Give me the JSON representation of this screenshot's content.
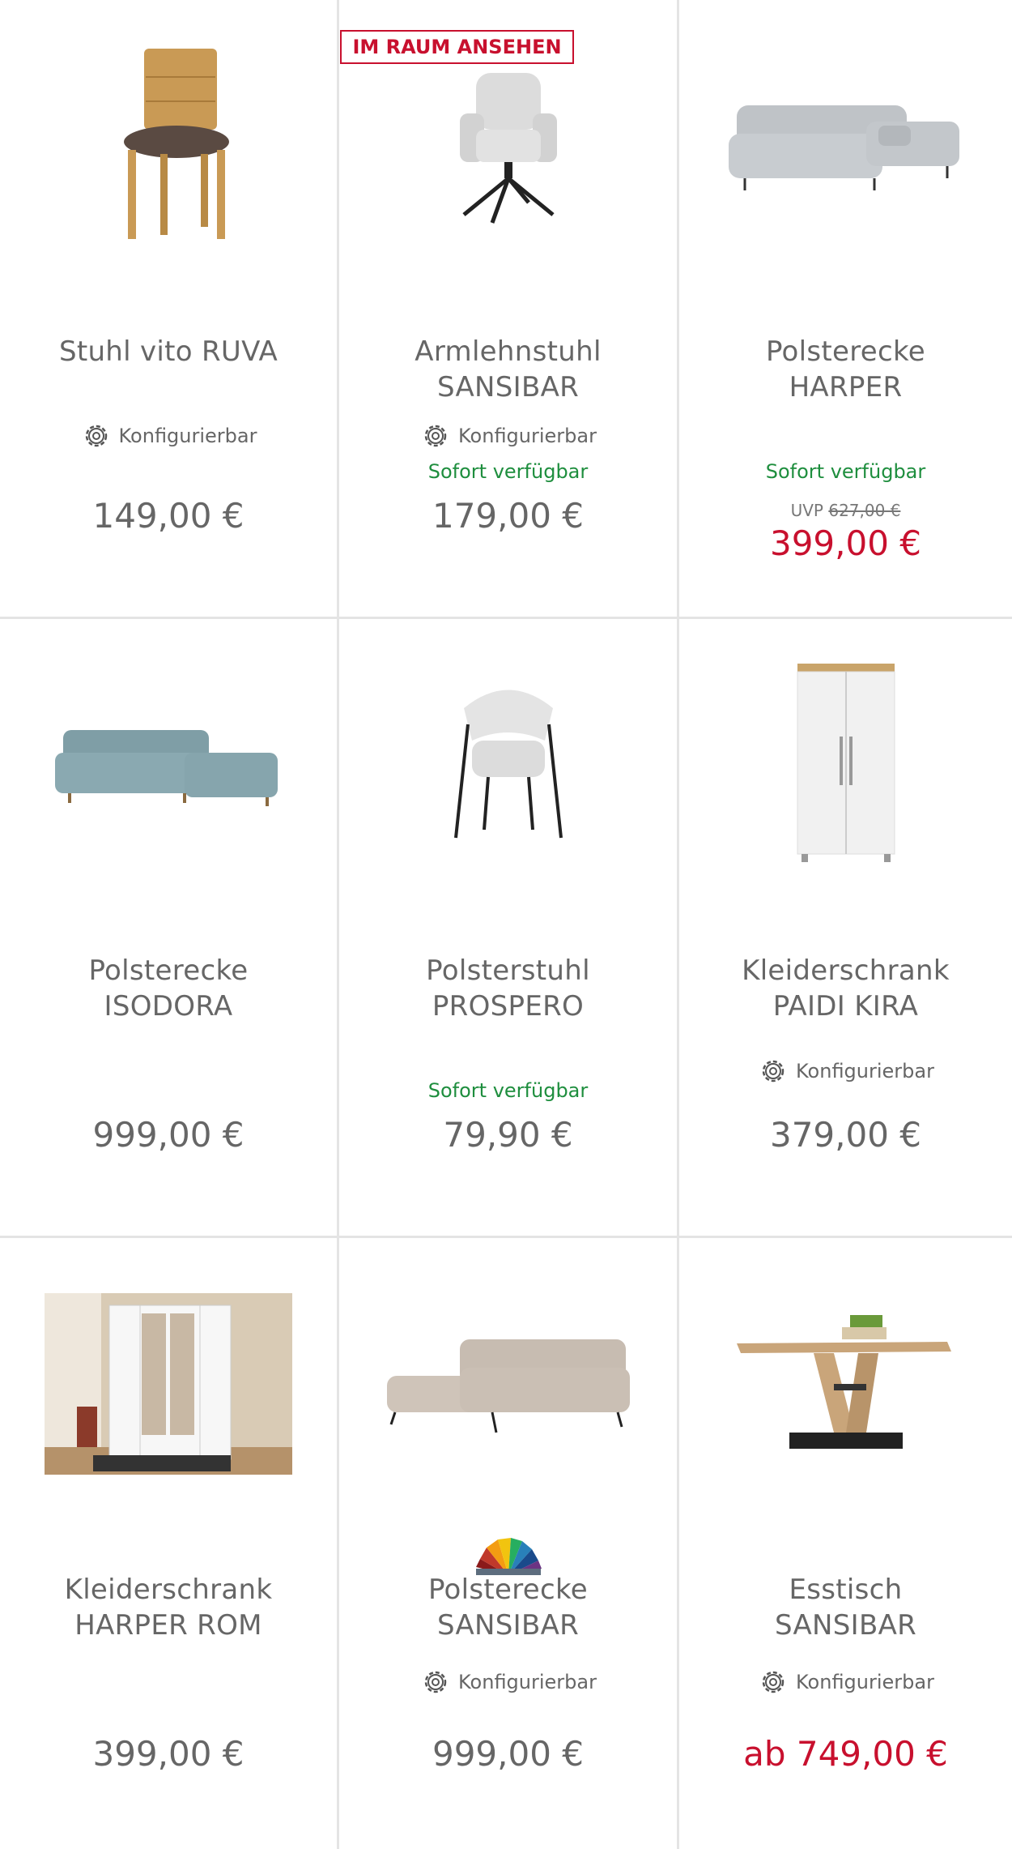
{
  "badge": "IM RAUM ANSEHEN",
  "products": [
    {
      "title_l1": "Stuhl vito RUVA",
      "title_l2": "",
      "config": "Konfigurierbar",
      "availability": "",
      "uvp_label": "",
      "uvp_value": "",
      "price": "149,00 €",
      "image": "wooden-chair-icon"
    },
    {
      "title_l1": "Armlehnstuhl",
      "title_l2": "SANSIBAR",
      "config": "Konfigurierbar",
      "availability": "Sofort verfügbar",
      "uvp_label": "",
      "uvp_value": "",
      "price": "179,00 €",
      "image": "swivel-armchair-icon"
    },
    {
      "title_l1": "Polsterecke",
      "title_l2": "HARPER",
      "config": "",
      "availability": "Sofort verfügbar",
      "uvp_label": "UVP",
      "uvp_value": "627,00 €",
      "price": "399,00 €",
      "image": "grey-corner-sofa-icon"
    },
    {
      "title_l1": "Polsterecke",
      "title_l2": "ISODORA",
      "config": "",
      "availability": "",
      "uvp_label": "",
      "uvp_value": "",
      "price": "999,00 €",
      "image": "blue-corner-sofa-icon"
    },
    {
      "title_l1": "Polsterstuhl",
      "title_l2": "PROSPERO",
      "config": "",
      "availability": "Sofort verfügbar",
      "uvp_label": "",
      "uvp_value": "",
      "price": "79,90 €",
      "image": "upholstered-chair-icon"
    },
    {
      "title_l1": "Kleiderschrank",
      "title_l2": "PAIDI KIRA",
      "config": "Konfigurierbar",
      "availability": "",
      "uvp_label": "",
      "uvp_value": "",
      "price": "379,00 €",
      "image": "white-wardrobe-icon"
    },
    {
      "title_l1": "Kleiderschrank",
      "title_l2": "HARPER ROM",
      "config": "",
      "availability": "",
      "uvp_label": "",
      "uvp_value": "",
      "price": "399,00 €",
      "image": "wardrobe-room-photo-icon"
    },
    {
      "title_l1": "Polsterecke",
      "title_l2": "SANSIBAR",
      "config": "Konfigurierbar",
      "availability": "",
      "uvp_label": "",
      "uvp_value": "",
      "price": "999,00 €",
      "image": "beige-corner-sofa-icon"
    },
    {
      "title_l1": "Esstisch",
      "title_l2": "SANSIBAR",
      "config": "Konfigurierbar",
      "availability": "",
      "uvp_label": "",
      "uvp_value": "",
      "price": "ab 749,00 €",
      "image": "dining-table-icon"
    }
  ],
  "colors": {
    "sale": "#c8102e",
    "available": "#1e8e3e",
    "text": "#666666",
    "divider": "#e4e4e4"
  }
}
